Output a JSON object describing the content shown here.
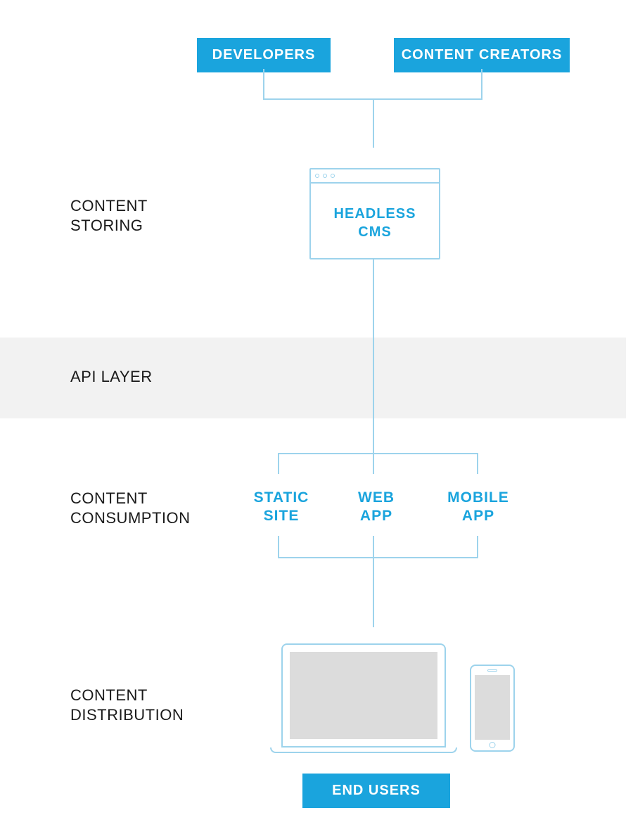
{
  "personas": {
    "left": "DEVELOPERS",
    "right": "CONTENT CREATORS"
  },
  "sections": {
    "storing_l1": "CONTENT",
    "storing_l2": "STORING",
    "api": "API LAYER",
    "consume_l1": "CONTENT",
    "consume_l2": "CONSUMPTION",
    "distrib_l1": "CONTENT",
    "distrib_l2": "DISTRIBUTION"
  },
  "cms": {
    "line1": "HEADLESS",
    "line2": "CMS"
  },
  "consumers": {
    "c1_l1": "STATIC",
    "c1_l2": "SITE",
    "c2_l1": "WEB",
    "c2_l2": "APP",
    "c3_l1": "MOBILE",
    "c3_l2": "APP"
  },
  "endusers": "END USERS",
  "colors": {
    "brand": "#1aa4dd",
    "line": "#9dd3ec",
    "band": "#f2f2f2",
    "screen": "#dcdcdc"
  }
}
